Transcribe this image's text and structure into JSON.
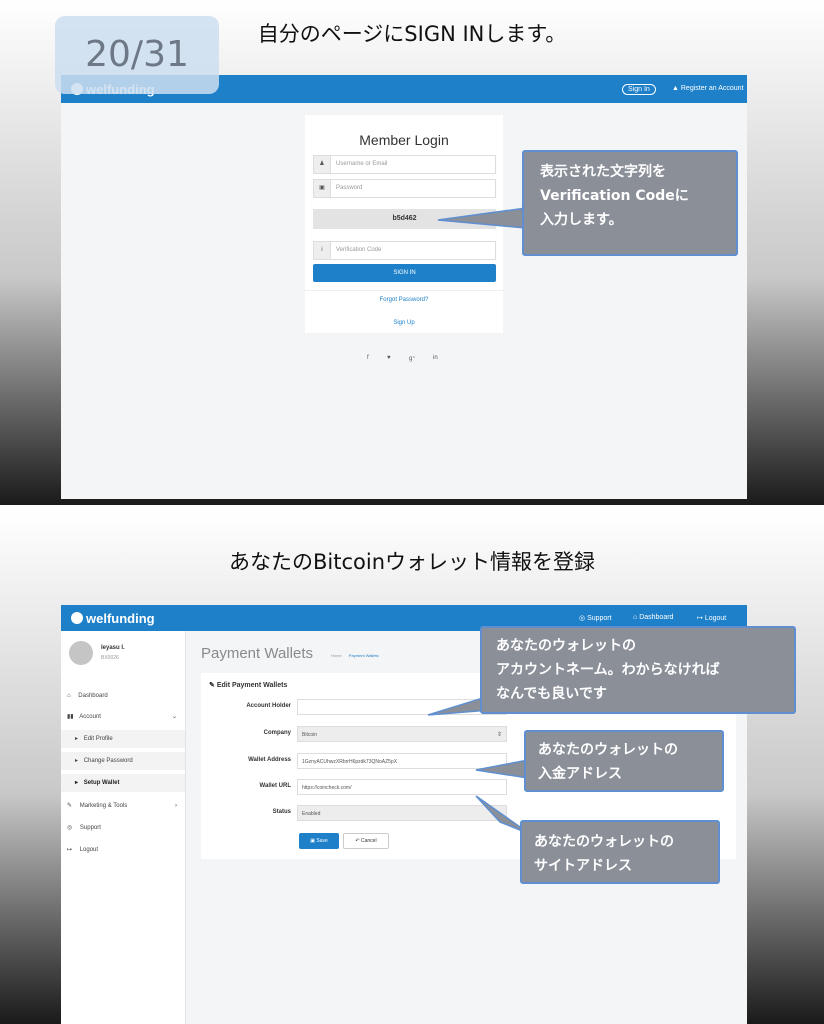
{
  "slide_counter": "20/31",
  "slide1": {
    "title": "自分のページにSIGN INします。",
    "app": {
      "logo": "welfunding",
      "nav": {
        "sign_in": "Sign In",
        "register": "Register an Account"
      },
      "login": {
        "title": "Member Login",
        "username_placeholder": "Username or Email",
        "password_placeholder": "Password",
        "captcha_code": "b5d462",
        "verification_placeholder": "Verification Code",
        "signin_label": "SIGN IN",
        "forgot_label": "Forgot Password?",
        "signup_label": "Sign Up"
      },
      "social": [
        "f",
        "♥",
        "g⁺",
        "in"
      ]
    },
    "callout": "表示された文字列を\nVerification Codeに\n入力します。"
  },
  "slide2": {
    "title": "あなたのBitcoinウォレット情報を登録",
    "app": {
      "logo": "welfunding",
      "nav": {
        "support": "Support",
        "dashboard": "Dashboard",
        "logout": "Logout"
      },
      "user": {
        "name": "Ieyasu I.",
        "sub": "BX0026"
      },
      "sidebar": [
        {
          "icon": "⌂",
          "label": "Dashboard"
        },
        {
          "icon": "▮▮",
          "label": "Account",
          "caret": "⌄"
        },
        {
          "icon": "▸",
          "label": "Edit Profile"
        },
        {
          "icon": "▸",
          "label": "Change Password"
        },
        {
          "icon": "▸",
          "label": "Setup Wallet"
        },
        {
          "icon": "✎",
          "label": "Marketing & Tools",
          "caret": "›"
        },
        {
          "icon": "◎",
          "label": "Support"
        },
        {
          "icon": "↦",
          "label": "Logout"
        }
      ],
      "page_title": "Payment Wallets",
      "breadcrumb": {
        "home": "Home",
        "current": "Payment Wallets"
      },
      "form": {
        "heading": "Edit Payment Wallets",
        "account_holder_label": "Account Holder",
        "account_holder_value": "",
        "company_label": "Company",
        "company_value": "Bitcoin",
        "wallet_address_label": "Wallet Address",
        "wallet_address_value": "1GznyACUhwzXRbrrH6pzdk73QNoAZ5pX",
        "wallet_url_label": "Wallet URL",
        "wallet_url_value": "https://coincheck.com/",
        "status_label": "Status",
        "status_value": "Enabled",
        "save_label": "Save",
        "cancel_label": "Cancel"
      }
    },
    "callouts": {
      "account_name": "あなたのウォレットの\nアカウントネーム。わからなければ\nなんでも良いです",
      "deposit_address": "あなたのウォレットの\n入金アドレス",
      "site_address": "あなたのウォレットの\nサイトアドレス"
    }
  }
}
